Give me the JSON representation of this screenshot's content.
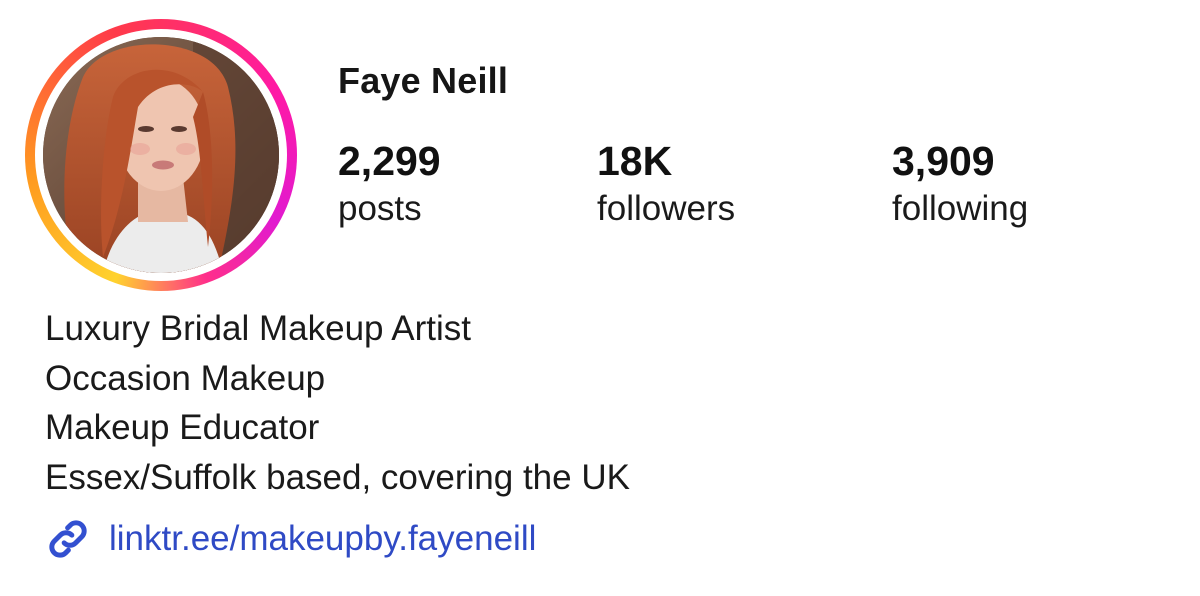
{
  "profile": {
    "username": "Faye Neill",
    "avatar_ring_colors": [
      "#ffd22e",
      "#ff9a1f",
      "#ff3a4a",
      "#ff1aa4",
      "#e11ad0"
    ],
    "stats": [
      {
        "value": "2,299",
        "label": "posts"
      },
      {
        "value": "18K",
        "label": "followers"
      },
      {
        "value": "3,909",
        "label": "following"
      }
    ],
    "bio": [
      "Luxury Bridal Makeup Artist",
      "Occasion Makeup",
      "Makeup Educator",
      "Essex/Suffolk based, covering the UK"
    ],
    "link": {
      "icon": "link-icon",
      "text": "linktr.ee/makeupby.fayeneill",
      "color": "#2f4ac5"
    }
  }
}
